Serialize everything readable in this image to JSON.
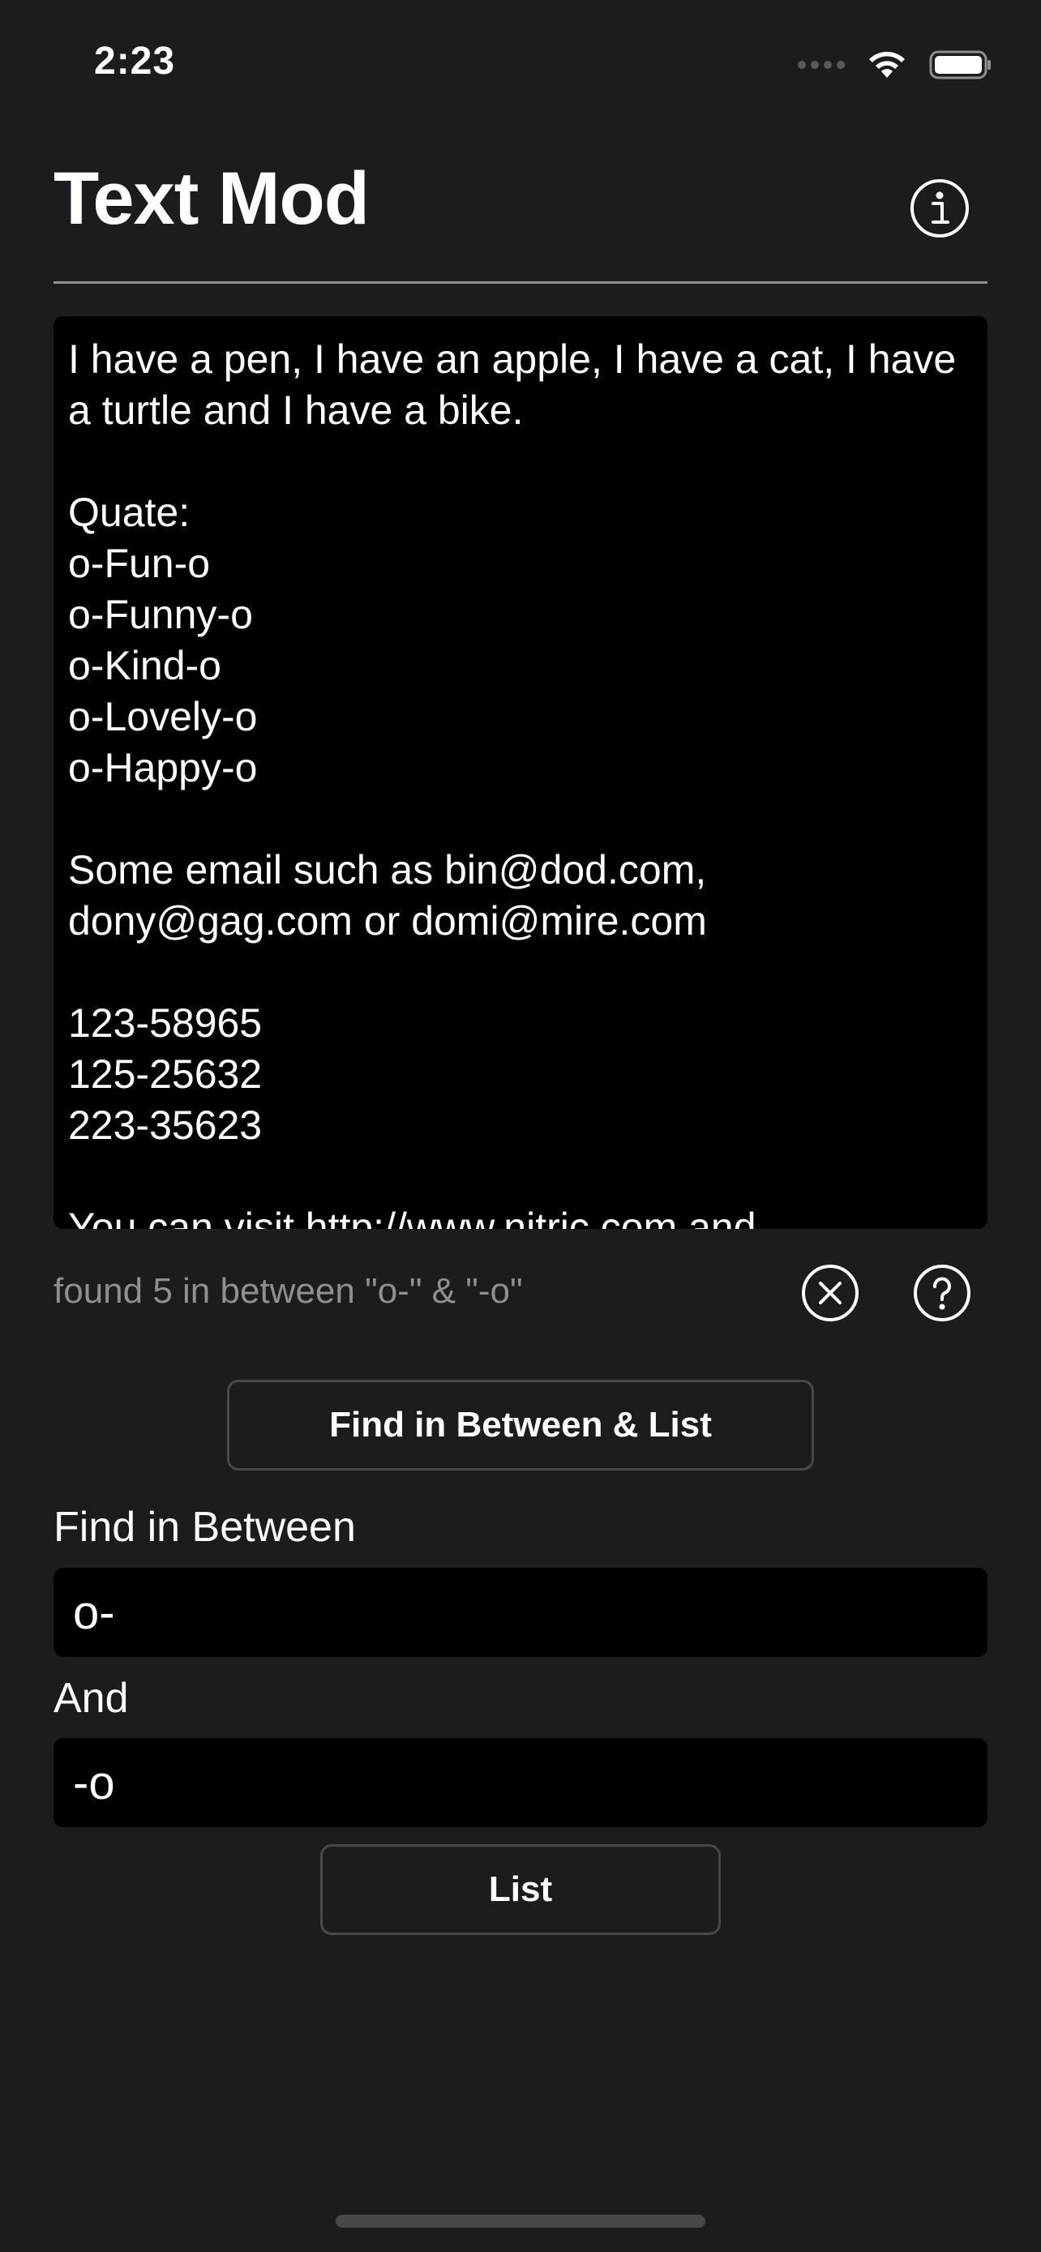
{
  "status_bar": {
    "time": "2:23"
  },
  "header": {
    "title": "Text Mod",
    "info_icon": "info-circle-icon"
  },
  "editor": {
    "content": "I have a pen, I have an apple, I have a cat, I have a turtle and I have a bike.\n\nQuate:\no-Fun-o\no-Funny-o\no-Kind-o\no-Lovely-o\no-Happy-o\n\nSome email such as bin@dod.com, dony@gag.com or domi@mire.com\n\n123-58965\n125-25632\n223-35623\n\nYou can visit http://www.nitric.com and"
  },
  "result": {
    "text": "found 5 in between \"o-\" & \"-o\"",
    "clear_icon": "x-circle-icon",
    "help_icon": "question-circle-icon"
  },
  "actions": {
    "find_between_list_label": "Find in Between & List",
    "list_label": "List"
  },
  "form": {
    "between_label": "Find in Between",
    "between_value": "o-",
    "and_label": "And",
    "and_value": "-o"
  },
  "colors": {
    "background": "#1c1c1e",
    "field_background": "#000000",
    "secondary_text": "#8e8e93",
    "button_border": "#48484a"
  }
}
